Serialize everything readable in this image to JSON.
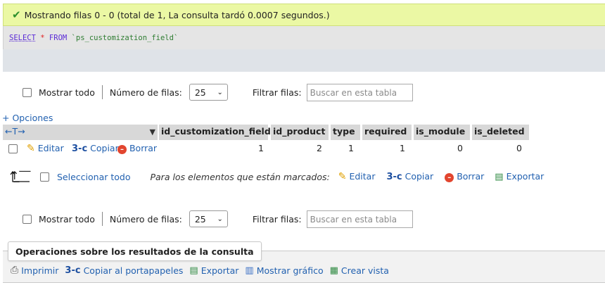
{
  "message": {
    "text": "Mostrando filas 0 - 0 (total de 1, La consulta tardó 0.0007 segundos.)"
  },
  "sql": {
    "select_kw": "SELECT",
    "star": "*",
    "from_kw": "FROM",
    "table": "`ps_customization_field`"
  },
  "nav_top": {
    "show_all": "Mostrar todo",
    "rows_label": "Número de filas:",
    "rows_value": "25",
    "filter_label": "Filtrar filas:",
    "filter_placeholder": "Buscar en esta tabla"
  },
  "nav_bottom": {
    "show_all": "Mostrar todo",
    "rows_label": "Número de filas:",
    "rows_value": "25",
    "filter_label": "Filtrar filas:",
    "filter_placeholder": "Buscar en esta tabla"
  },
  "options_link": "+ Opciones",
  "table": {
    "arrows": "←T→",
    "columns": [
      "id_customization_field",
      "id_product",
      "type",
      "required",
      "is_module",
      "is_deleted"
    ],
    "rows": [
      {
        "edit": "Editar",
        "copy": "Copiar",
        "delete": "Borrar",
        "values": [
          "1",
          "2",
          "1",
          "1",
          "0",
          "0"
        ]
      }
    ]
  },
  "bulk": {
    "select_all": "Seleccionar todo",
    "marked_label": "Para los elementos que están marcados:",
    "edit": "Editar",
    "copy": "Copiar",
    "delete": "Borrar",
    "export": "Exportar"
  },
  "operations": {
    "title": "Operaciones sobre los resultados de la consulta",
    "print": "Imprimir",
    "copy_clipboard": "Copiar al portapapeles",
    "export": "Exportar",
    "chart": "Mostrar gráfico",
    "create_view": "Crear vista"
  }
}
